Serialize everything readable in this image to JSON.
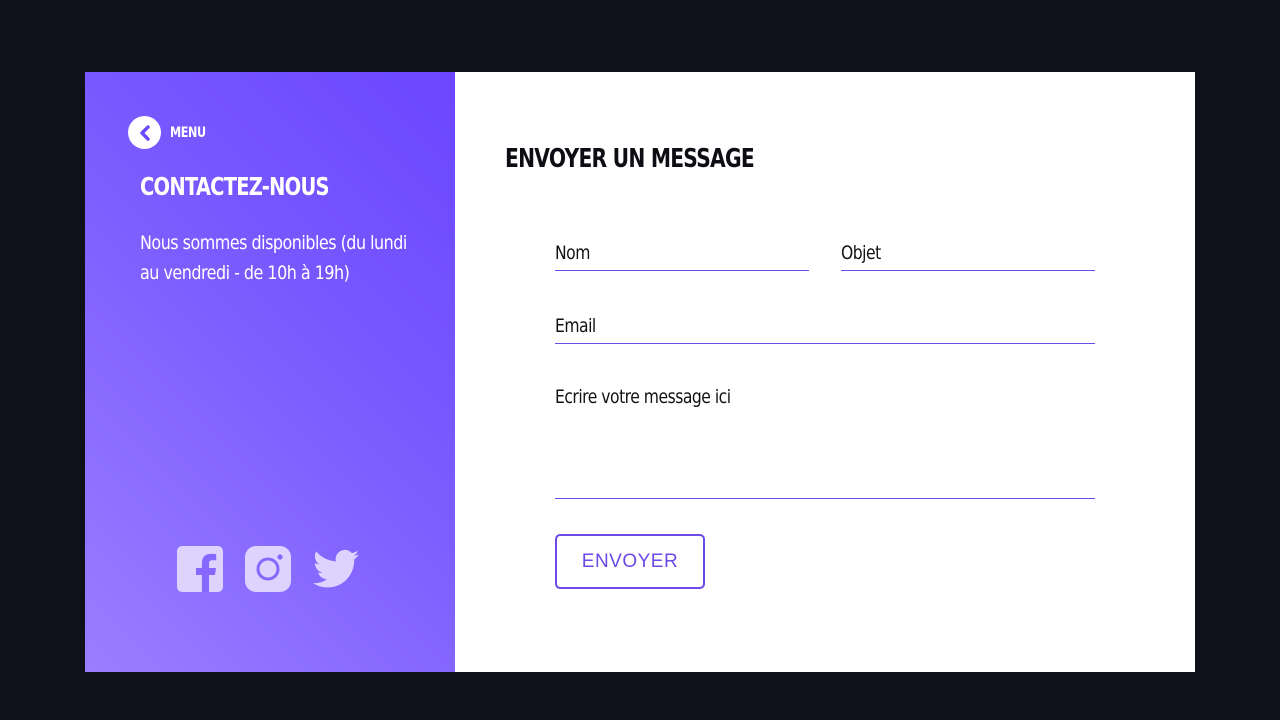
{
  "menu": {
    "label": "MENU",
    "icon": "chevron-left-icon"
  },
  "contact": {
    "title": "CONTACTEZ-NOUS",
    "description": "Nous sommes disponibles (du lundi au vendredi - de 10h à 19h)"
  },
  "socials": [
    {
      "name": "facebook-icon"
    },
    {
      "name": "instagram-icon"
    },
    {
      "name": "twitter-icon"
    }
  ],
  "form": {
    "title": "ENVOYER UN MESSAGE",
    "nom_label": "Nom",
    "objet_label": "Objet",
    "email_label": "Email",
    "message_label": "Ecrire votre message ici",
    "submit_label": "ENVOYER"
  },
  "colors": {
    "background": "#0e111a",
    "accent": "#6c4ae8",
    "panel_gradient_start": "#6a46ff",
    "panel_gradient_end": "#9a7eff"
  }
}
